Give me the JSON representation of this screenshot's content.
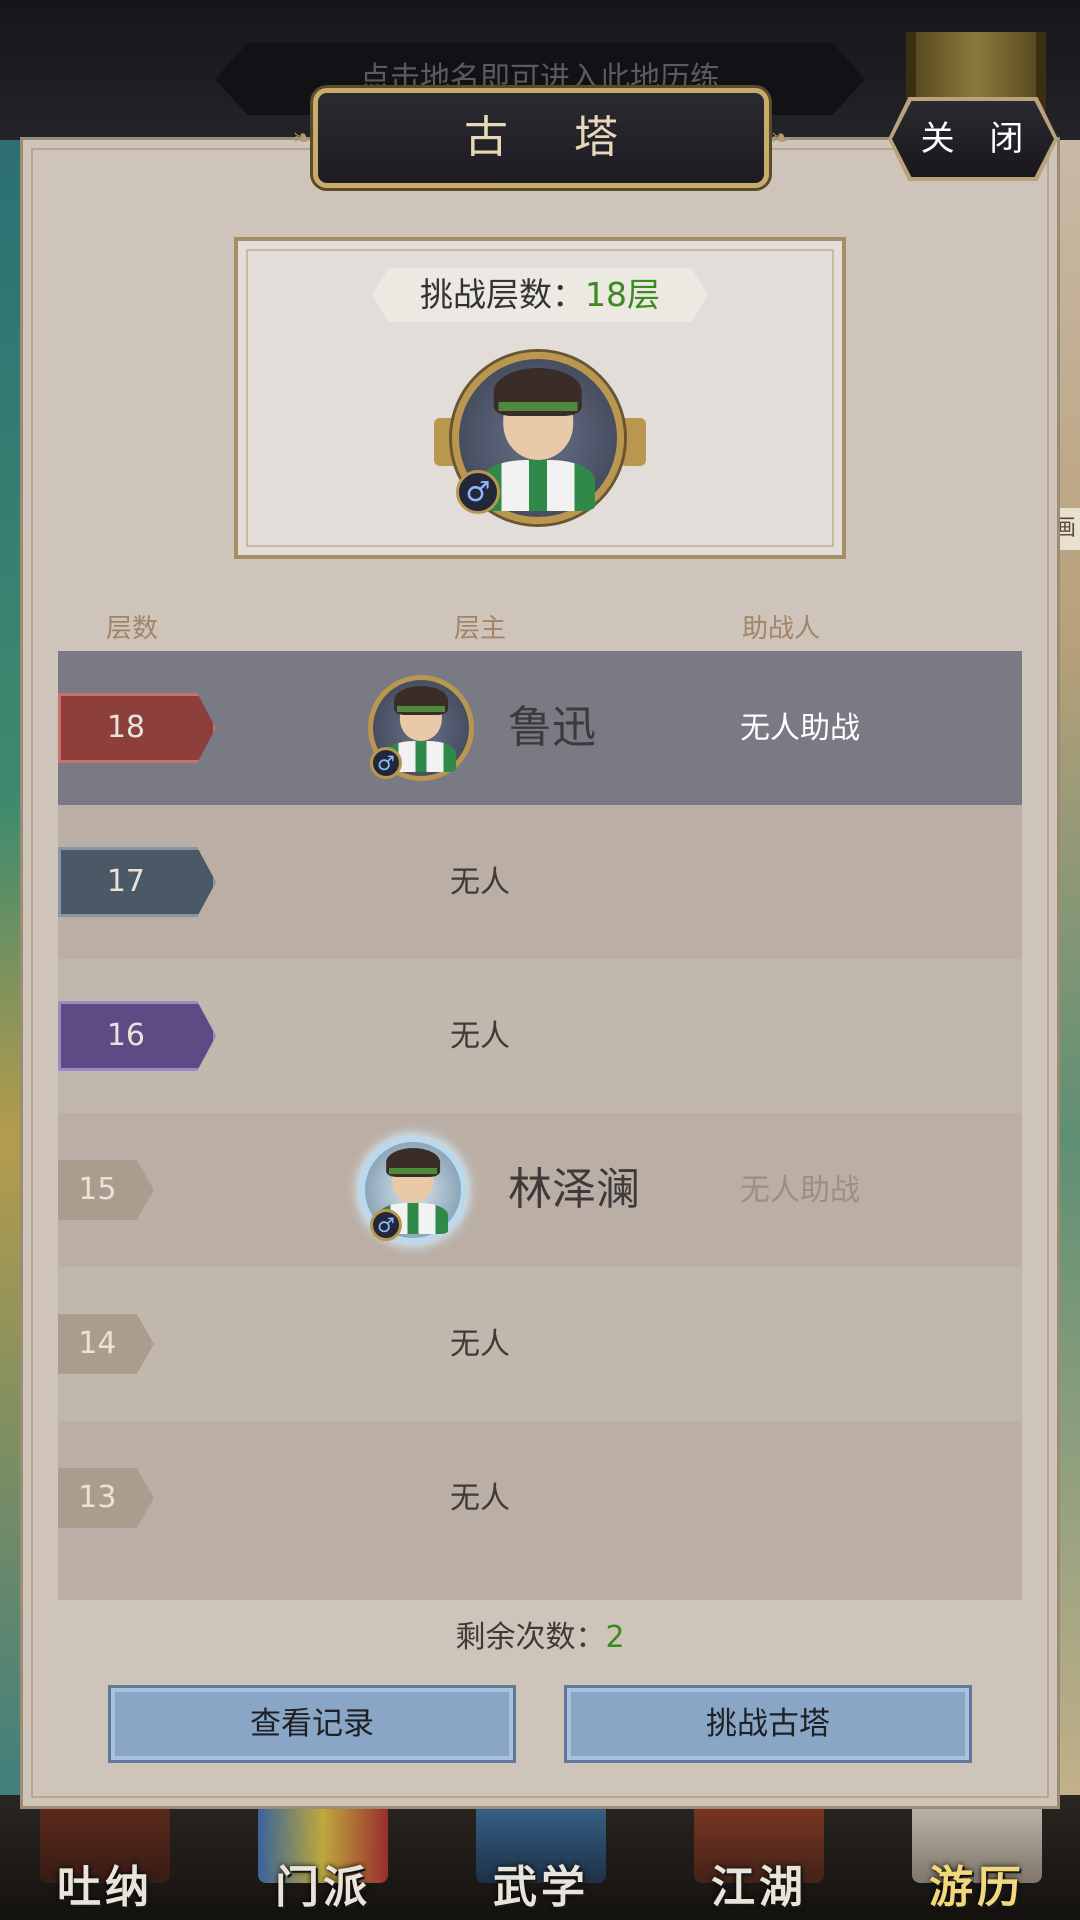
{
  "hint_banner": "点击地名即可进入此地历练",
  "side_tag": "画",
  "dialog": {
    "title": "古 塔",
    "close_label": "关 闭"
  },
  "challenge": {
    "label": "挑战层数：",
    "value": "18层"
  },
  "gender_symbol": "♂",
  "table": {
    "headers": {
      "floor": "层数",
      "owner": "层主",
      "helper": "助战人"
    },
    "rows": [
      {
        "floor": "18",
        "owner": "鲁迅",
        "helper": "无人助战"
      },
      {
        "floor": "17",
        "owner": "无人"
      },
      {
        "floor": "16",
        "owner": "无人"
      },
      {
        "floor": "15",
        "owner": "林泽澜",
        "helper": "无人助战"
      },
      {
        "floor": "14",
        "owner": "无人"
      },
      {
        "floor": "13",
        "owner": "无人"
      }
    ]
  },
  "remaining": {
    "label": "剩余次数：",
    "count": "2"
  },
  "buttons": {
    "view_records": "查看记录",
    "challenge_tower": "挑战古塔"
  },
  "bottom_nav": [
    {
      "label": "吐纳"
    },
    {
      "label": "门派"
    },
    {
      "label": "武学"
    },
    {
      "label": "江湖"
    },
    {
      "label": "游历"
    }
  ],
  "colors": {
    "accent_green": "#3b8a22",
    "highlight_row": "#7a7a85",
    "button_blue": "#8aa6c6",
    "gold_trim": "#b9974f"
  }
}
